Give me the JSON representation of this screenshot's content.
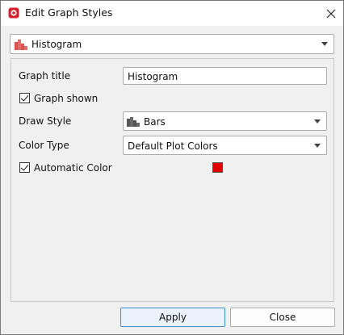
{
  "window": {
    "title": "Edit Graph Styles"
  },
  "graph_selector": {
    "value": "Histogram"
  },
  "form": {
    "graph_title_label": "Graph title",
    "graph_title_value": "Histogram",
    "graph_shown_label": "Graph shown",
    "graph_shown_checked": true,
    "draw_style_label": "Draw Style",
    "draw_style_value": "Bars",
    "color_type_label": "Color Type",
    "color_type_value": "Default Plot Colors",
    "automatic_color_label": "Automatic Color",
    "automatic_color_checked": true,
    "color_swatch": "#e00000"
  },
  "buttons": {
    "apply": "Apply",
    "close": "Close"
  },
  "icons": {
    "app": "app-icon",
    "close": "close-icon",
    "histogram": "histogram-icon",
    "bars": "bars-icon"
  }
}
